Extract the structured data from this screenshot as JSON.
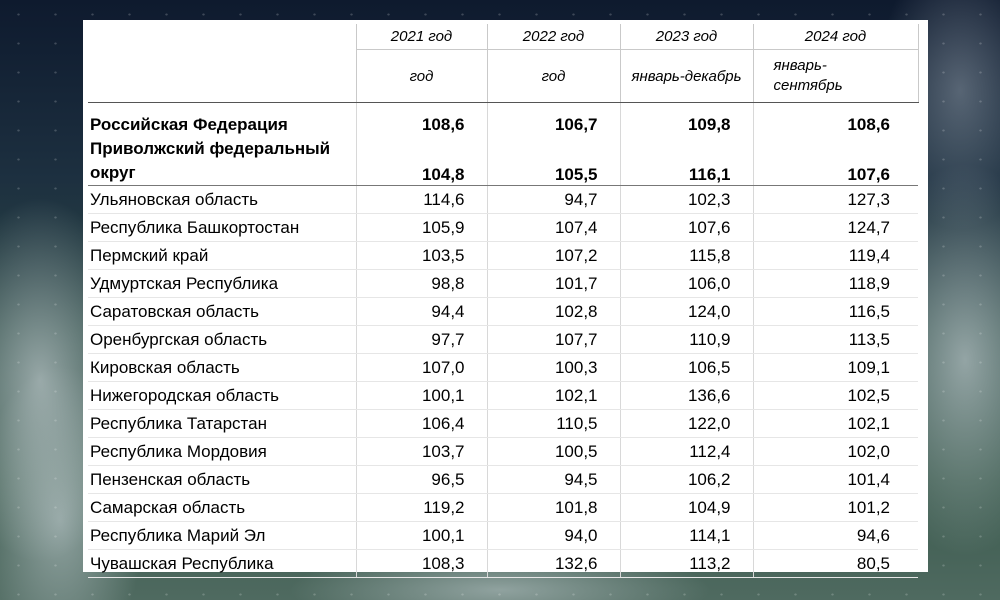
{
  "header": {
    "years": [
      "2021 год",
      "2022 год",
      "2023 год",
      "2024 год"
    ],
    "periods": [
      "год",
      "год",
      "январь-декабрь",
      "январь-\nсентябрь"
    ]
  },
  "summary_rows": [
    {
      "name": "Российская Федерация",
      "values": [
        "108,6",
        "106,7",
        "109,8",
        "108,6"
      ]
    },
    {
      "name": "Приволжский федеральный округ",
      "values": [
        "104,8",
        "105,5",
        "116,1",
        "107,6"
      ]
    }
  ],
  "rows": [
    {
      "name": "Ульяновская область",
      "values": [
        "114,6",
        "94,7",
        "102,3",
        "127,3"
      ]
    },
    {
      "name": "Республика Башкортостан",
      "values": [
        "105,9",
        "107,4",
        "107,6",
        "124,7"
      ]
    },
    {
      "name": "Пермский край",
      "values": [
        "103,5",
        "107,2",
        "115,8",
        "119,4"
      ]
    },
    {
      "name": "Удмуртская Республика",
      "values": [
        "98,8",
        "101,7",
        "106,0",
        "118,9"
      ]
    },
    {
      "name": "Саратовская область",
      "values": [
        "94,4",
        "102,8",
        "124,0",
        "116,5"
      ]
    },
    {
      "name": "Оренбургская область",
      "values": [
        "97,7",
        "107,7",
        "110,9",
        "113,5"
      ]
    },
    {
      "name": "Кировская область",
      "values": [
        "107,0",
        "100,3",
        "106,5",
        "109,1"
      ]
    },
    {
      "name": "Нижегородская область",
      "values": [
        "100,1",
        "102,1",
        "136,6",
        "102,5"
      ]
    },
    {
      "name": "Республика Татарстан",
      "values": [
        "106,4",
        "110,5",
        "122,0",
        "102,1"
      ]
    },
    {
      "name": "Республика Мордовия",
      "values": [
        "103,7",
        "100,5",
        "112,4",
        "102,0"
      ]
    },
    {
      "name": "Пензенская область",
      "values": [
        "96,5",
        "94,5",
        "106,2",
        "101,4"
      ]
    },
    {
      "name": "Самарская область",
      "values": [
        "119,2",
        "101,8",
        "104,9",
        "101,2"
      ]
    },
    {
      "name": "Республика Марий Эл",
      "values": [
        "100,1",
        "94,0",
        "114,1",
        "94,6"
      ]
    },
    {
      "name": "Чувашская Республика",
      "values": [
        "108,3",
        "132,6",
        "113,2",
        "80,5"
      ]
    }
  ]
}
